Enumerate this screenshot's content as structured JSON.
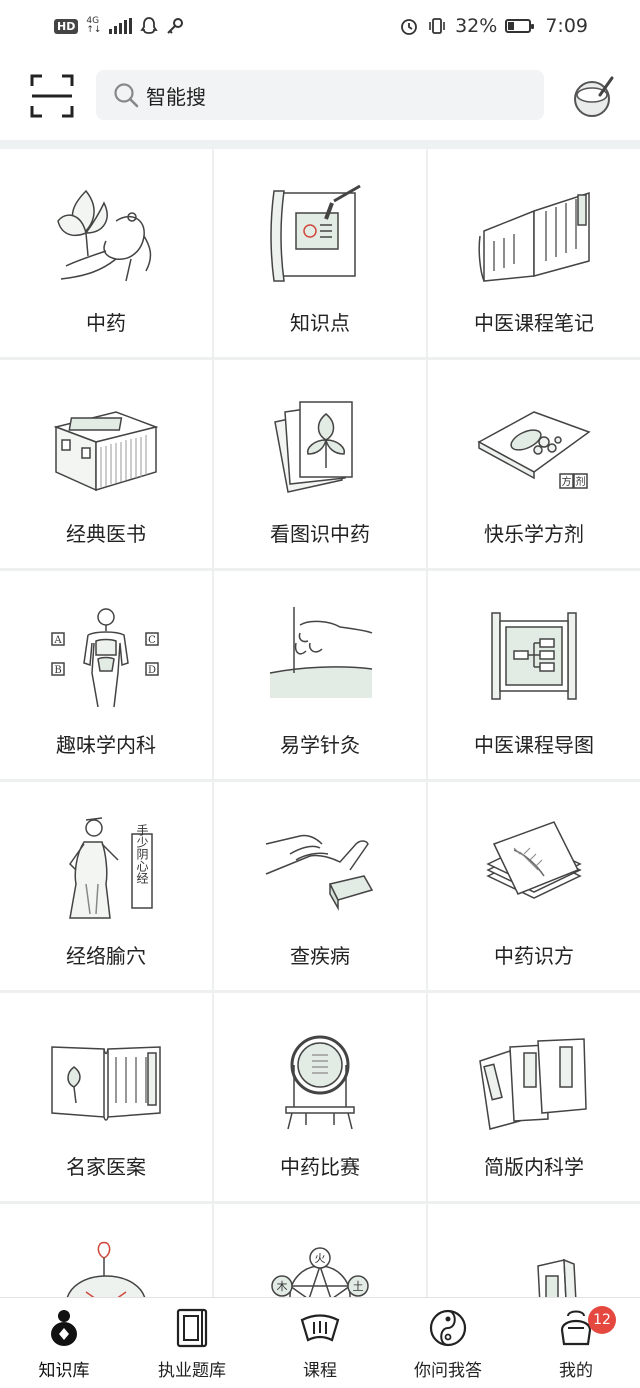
{
  "status_bar": {
    "battery": "32%",
    "time": "7:09",
    "network": "4G",
    "hd": "HD",
    "battery_level": 0.32
  },
  "search": {
    "placeholder": "智能搜"
  },
  "tiles": [
    {
      "label": "中药",
      "icon": "ginseng-icon"
    },
    {
      "label": "知识点",
      "icon": "scroll-brush-icon"
    },
    {
      "label": "中医课程笔记",
      "icon": "open-book-icon"
    },
    {
      "label": "经典医书",
      "icon": "book-box-icon"
    },
    {
      "label": "看图识中药",
      "icon": "leaf-cards-icon"
    },
    {
      "label": "快乐学方剂",
      "icon": "herb-mat-icon"
    },
    {
      "label": "趣味学内科",
      "icon": "anatomy-icon"
    },
    {
      "label": "易学针灸",
      "icon": "acupuncture-icon"
    },
    {
      "label": "中医课程导图",
      "icon": "mind-map-scroll-icon"
    },
    {
      "label": "经络腧穴",
      "icon": "meridian-figure-icon"
    },
    {
      "label": "查疾病",
      "icon": "pulse-diagnosis-icon"
    },
    {
      "label": "中药识方",
      "icon": "prescription-cards-icon"
    },
    {
      "label": "名家医案",
      "icon": "case-book-icon"
    },
    {
      "label": "中药比赛",
      "icon": "mirror-trophy-icon"
    },
    {
      "label": "简版内科学",
      "icon": "classic-books-icon"
    },
    {
      "label": "",
      "icon": "sachet-icon"
    },
    {
      "label": "",
      "icon": "five-elements-icon"
    },
    {
      "label": "",
      "icon": "medicine-box-icon"
    }
  ],
  "illustration_text": {
    "a": "A",
    "b": "B",
    "c": "C",
    "d": "D",
    "fang": "方",
    "ji": "剂",
    "meridian_label": "手少阴心经",
    "fire": "火",
    "wood": "木",
    "earth": "土"
  },
  "nav": {
    "items": [
      {
        "label": "知识库",
        "icon": "gourd-icon"
      },
      {
        "label": "执业题库",
        "icon": "notebook-icon"
      },
      {
        "label": "课程",
        "icon": "scroll-fan-icon"
      },
      {
        "label": "你问我答",
        "icon": "yin-yang-icon"
      },
      {
        "label": "我的",
        "icon": "profile-bag-icon"
      }
    ],
    "badge": "12"
  },
  "colors": {
    "accent_green": "#dfe8e2",
    "badge_red": "#e5483f"
  }
}
